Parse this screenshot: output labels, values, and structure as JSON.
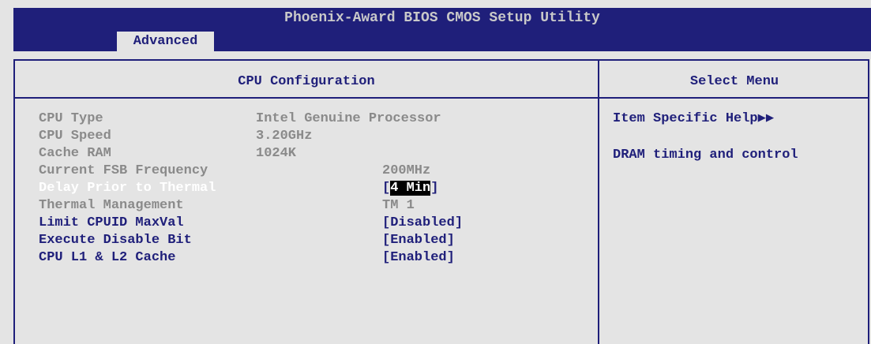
{
  "title": "Phoenix-Award BIOS CMOS Setup Utility",
  "tab": "Advanced",
  "main_title": "CPU Configuration",
  "help_title": "Select Menu",
  "items": [
    {
      "label": "CPU Type",
      "value": "Intel Genuine Processor"
    },
    {
      "label": "CPU Speed",
      "value": "3.20GHz"
    },
    {
      "label": "Cache RAM",
      "value": "1024K"
    },
    {
      "label": "Current FSB Frequency",
      "value": "200MHz"
    },
    {
      "label": "Delay Prior to Thermal",
      "value_open": "[",
      "value_sel": "4 Min",
      "value_close": "]"
    },
    {
      "label": "Thermal Management",
      "value": "TM 1"
    },
    {
      "label": "Limit CPUID MaxVal",
      "value": "[Disabled]"
    },
    {
      "label": "Execute Disable Bit",
      "value": "[Enabled]"
    },
    {
      "label": "CPU L1 & L2 Cache",
      "value": "[Enabled]"
    }
  ],
  "help": {
    "heading": "Item Specific Help▶▶",
    "text": "DRAM timing and control"
  },
  "colors": {
    "navy": "#1f1f7a",
    "background": "#e4e4e4",
    "info_gray": "#8a8a8a"
  }
}
